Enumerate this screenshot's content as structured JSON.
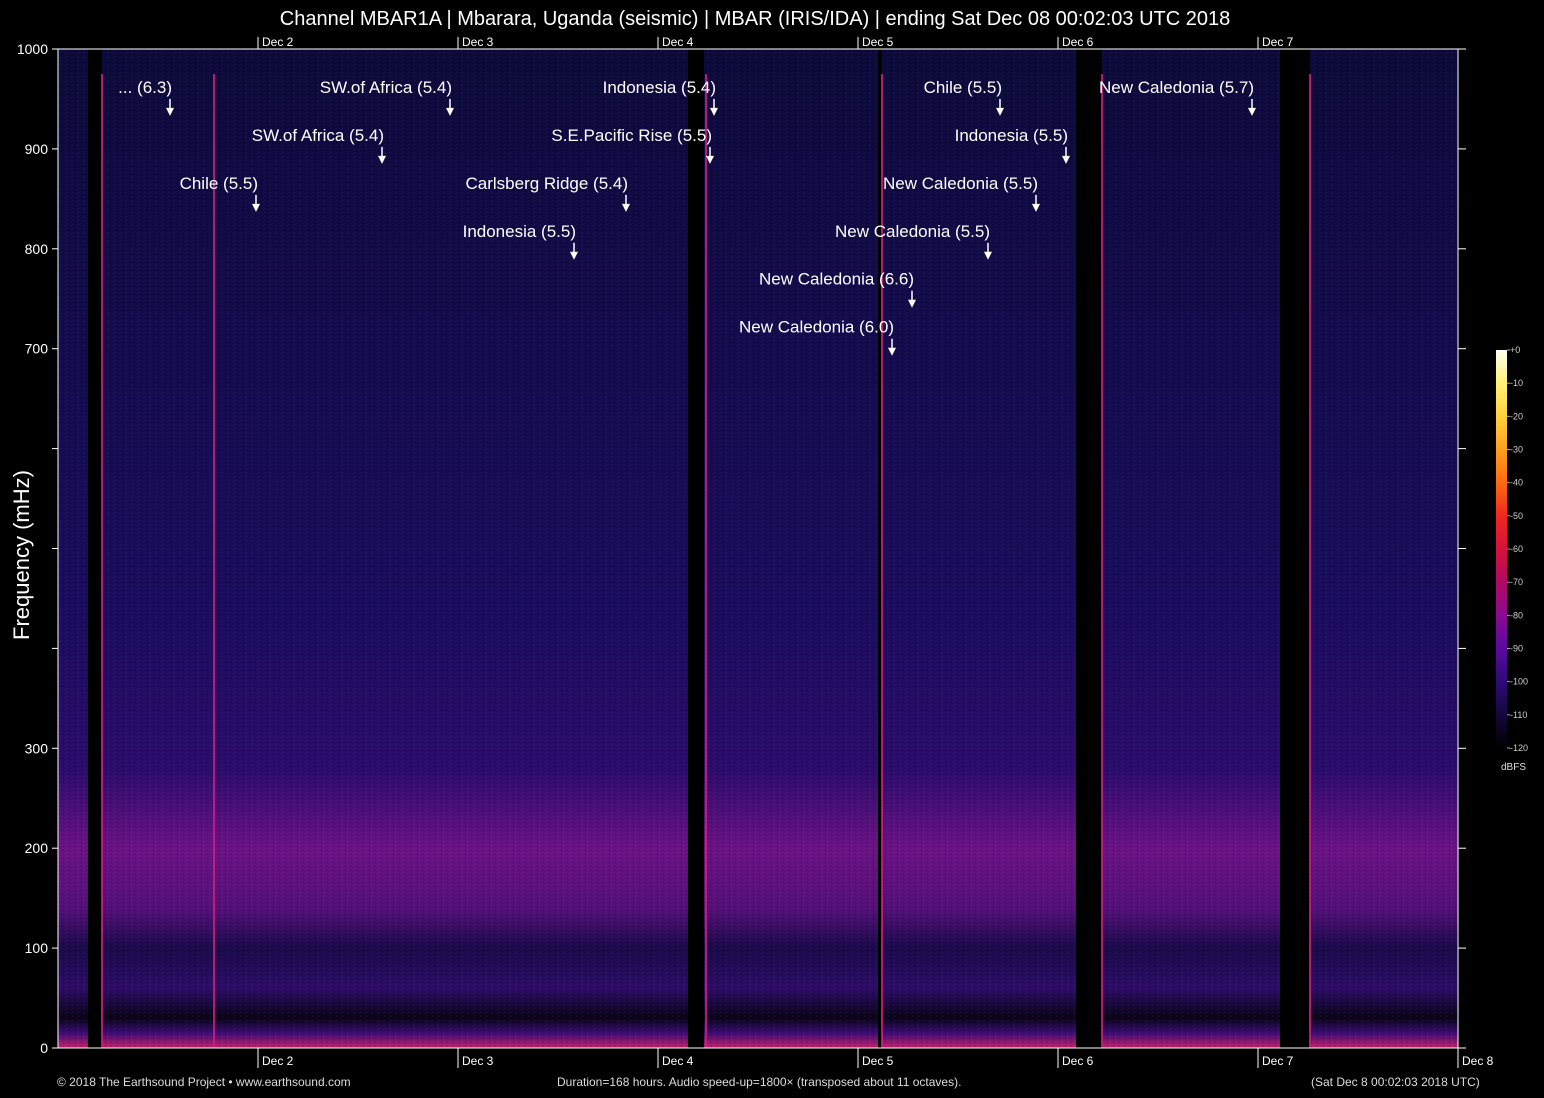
{
  "title": "Channel MBAR1A | Mbarara, Uganda (seismic) | MBAR (IRIS/IDA) | ending Sat Dec 08 00:02:03 UTC 2018",
  "footer": {
    "left": "© 2018 The Earthsound Project • www.earthsound.com",
    "center": "Duration=168 hours. Audio speed-up=1800× (transposed about 11 octaves).",
    "right": "(Sat Dec  8 00:02:03 2018 UTC)"
  },
  "colorbar": {
    "unit": "dBFS",
    "ticks": [
      "+0",
      "-10",
      "-20",
      "-30",
      "-40",
      "-50",
      "-60",
      "-70",
      "-80",
      "-90",
      "-100",
      "-110",
      "-120"
    ],
    "colors": [
      "#fffff0",
      "#fff176",
      "#ffd23c",
      "#ffa01e",
      "#ff6a10",
      "#f0281e",
      "#d8103c",
      "#b00a64",
      "#8a0a90",
      "#5a0aa0",
      "#2e0a78",
      "#14083c",
      "#000000"
    ]
  },
  "chart_data": {
    "type": "heatmap",
    "title": "Channel MBAR1A | Mbarara, Uganda (seismic) | MBAR (IRIS/IDA) | ending Sat Dec 08 00:02:03 UTC 2018",
    "xlabel": "",
    "ylabel": "Frequency (mHz)",
    "ylim": [
      0,
      1000
    ],
    "yticks": [
      0,
      100,
      200,
      300,
      400,
      500,
      600,
      700,
      800,
      900,
      1000
    ],
    "ytick_labels": [
      "0",
      "100",
      "200",
      "300",
      "",
      "",
      "",
      "700",
      "800",
      "900",
      "1000"
    ],
    "xlim_days": [
      1,
      8
    ],
    "x_top_ticks": [
      {
        "day": 2,
        "label": "Dec 2"
      },
      {
        "day": 3,
        "label": "Dec 3"
      },
      {
        "day": 4,
        "label": "Dec 4"
      },
      {
        "day": 5,
        "label": "Dec 5"
      },
      {
        "day": 6,
        "label": "Dec 6"
      },
      {
        "day": 7,
        "label": "Dec 7"
      }
    ],
    "x_bottom_ticks": [
      {
        "day": 2,
        "label": "Dec 2"
      },
      {
        "day": 3,
        "label": "Dec 3"
      },
      {
        "day": 4,
        "label": "Dec 4"
      },
      {
        "day": 5,
        "label": "Dec 5"
      },
      {
        "day": 6,
        "label": "Dec 6"
      },
      {
        "day": 7,
        "label": "Dec 7"
      },
      {
        "day": 8,
        "label": "Dec 8"
      }
    ],
    "colorbar_range_dbfs": [
      -120,
      0
    ],
    "grid": false,
    "data_gaps_days": [
      [
        1.15,
        1.22
      ],
      [
        4.15,
        4.23
      ],
      [
        5.1,
        5.12
      ],
      [
        6.09,
        6.22
      ],
      [
        7.11,
        7.26
      ]
    ],
    "bright_lines_days": [
      1.22,
      1.78,
      4.24,
      5.12,
      6.22,
      7.26
    ],
    "noise_band_mhz": [
      130,
      270
    ],
    "events": [
      {
        "label": "... (6.3)",
        "day": 1.56,
        "freq": 935
      },
      {
        "label": "SW.of Africa (5.4)",
        "day": 2.96,
        "freq": 935
      },
      {
        "label": "Indonesia (5.4)",
        "day": 4.28,
        "freq": 935
      },
      {
        "label": "Chile (5.5)",
        "day": 5.71,
        "freq": 935
      },
      {
        "label": "New Caledonia (5.7)",
        "day": 6.97,
        "freq": 935
      },
      {
        "label": "SW.of Africa (5.4)",
        "day": 2.62,
        "freq": 887
      },
      {
        "label": "S.E.Pacific Rise (5.5)",
        "day": 4.26,
        "freq": 887
      },
      {
        "label": "Indonesia (5.5)",
        "day": 6.04,
        "freq": 887
      },
      {
        "label": "Chile (5.5)",
        "day": 1.99,
        "freq": 839
      },
      {
        "label": "Carlsberg Ridge (5.4)",
        "day": 3.84,
        "freq": 839
      },
      {
        "label": "New Caledonia (5.5)",
        "day": 5.89,
        "freq": 839
      },
      {
        "label": "Indonesia (5.5)",
        "day": 3.58,
        "freq": 791
      },
      {
        "label": "New Caledonia (5.5)",
        "day": 5.65,
        "freq": 791
      },
      {
        "label": "New Caledonia (6.6)",
        "day": 5.27,
        "freq": 743
      },
      {
        "label": "New Caledonia (6.0)",
        "day": 5.17,
        "freq": 695
      }
    ]
  }
}
